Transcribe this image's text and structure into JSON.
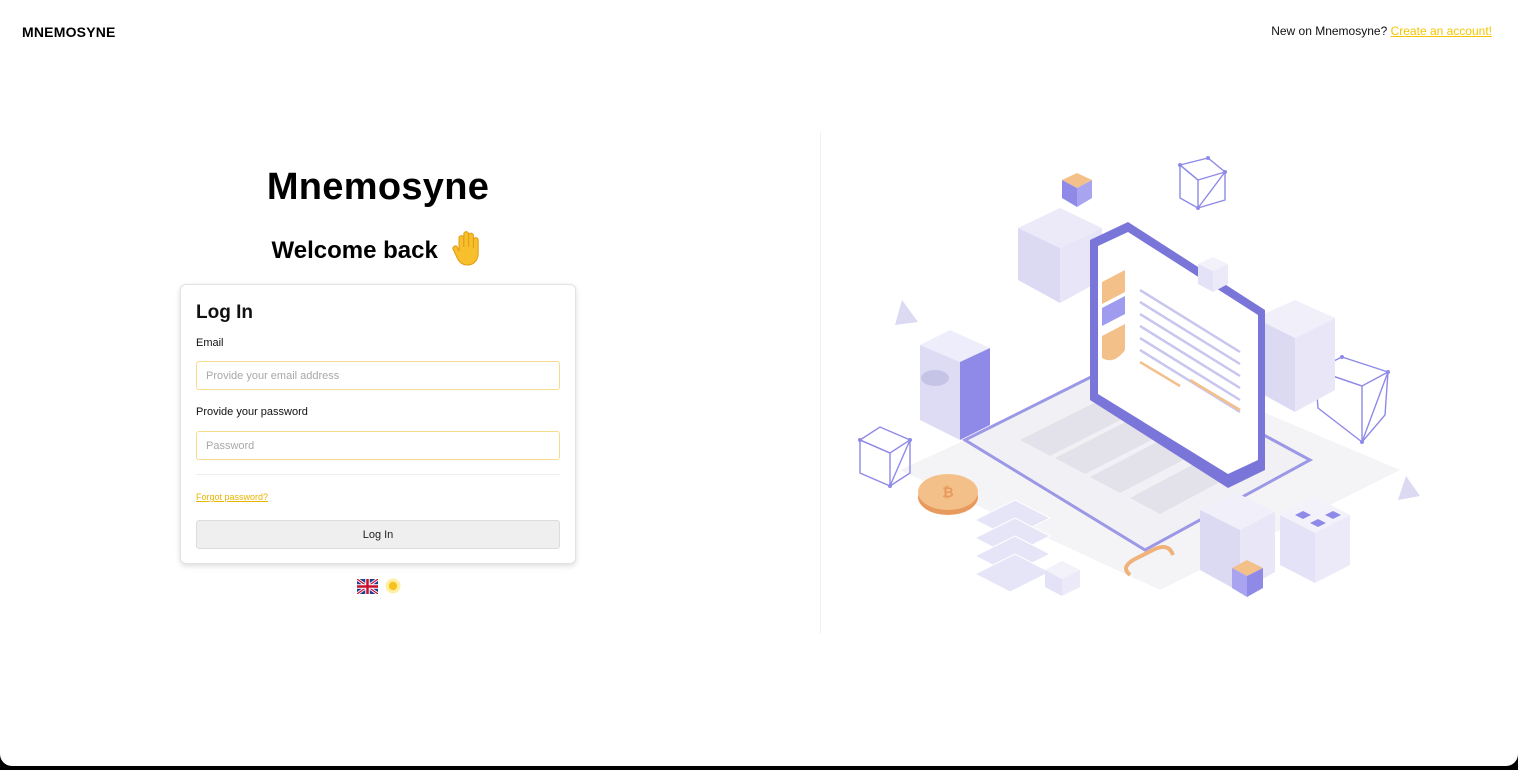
{
  "header": {
    "brand": "MNEMOSYNE",
    "signup_prompt": "New on Mnemosyne?",
    "signup_link": "Create an account!"
  },
  "hero": {
    "app_name": "Mnemosyne",
    "welcome": "Welcome back"
  },
  "login_form": {
    "title": "Log In",
    "email_label": "Email",
    "email_placeholder": "Provide your email address",
    "email_value": "",
    "password_label": "Provide your password",
    "password_placeholder": "Password",
    "password_value": "",
    "forgot_link": "Forgot password?",
    "submit_label": "Log In"
  },
  "footer_icons": [
    "uk-flag-icon",
    "sun-icon"
  ],
  "illustration": "isometric-laptop-illustration",
  "colors": {
    "accent_yellow": "#f5c400",
    "input_border": "#f6dc8c",
    "illustration_purple": "#7f7ae6",
    "illustration_orange": "#f0b27a"
  }
}
